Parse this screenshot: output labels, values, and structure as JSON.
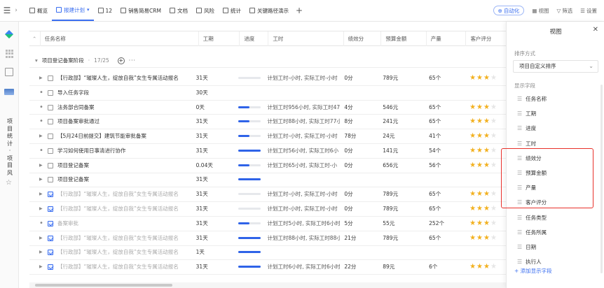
{
  "topbar": {
    "tabs": [
      {
        "label": "概览",
        "icon": "dashboard-icon"
      },
      {
        "label": "报建计划",
        "icon": "table-icon",
        "active": true
      },
      {
        "label": "12",
        "icon": "image-icon"
      },
      {
        "label": "销售简易CRM",
        "icon": "crm-icon"
      },
      {
        "label": "文档",
        "icon": "doc-icon"
      },
      {
        "label": "风险",
        "icon": "warning-icon"
      },
      {
        "label": "统计",
        "icon": "chart-icon"
      },
      {
        "label": "关键路径演示",
        "icon": "gantt-icon"
      }
    ],
    "automation_label": "自动化",
    "view_label": "视图",
    "filter_label": "筛选",
    "settings_label": "设置"
  },
  "rail": {
    "vertical_text": "项目统计·项目风"
  },
  "table": {
    "headers": [
      "任务名称",
      "工期",
      "进度",
      "工时",
      "绩效分",
      "预算金额",
      "产量",
      "客户评分"
    ],
    "group": {
      "title": "项目登记备案阶段",
      "count": "17/25"
    },
    "rows": [
      {
        "name": "【行政部】“璀璨人生，绽放自我”女生专属活动报名",
        "days": "31天",
        "progress": 0,
        "time": "计划工时-小时, 实际工时-小时",
        "perf": "0分",
        "budget": "789元",
        "output": "65个",
        "rating": 3,
        "expand": true,
        "done": false
      },
      {
        "name": "导入任务字段",
        "days": "30天",
        "progress": null,
        "time": "",
        "perf": "",
        "budget": "",
        "output": "",
        "rating": 0,
        "expand": false,
        "done": false
      },
      {
        "name": "法务部合同备案",
        "days": "0天",
        "progress": 0.5,
        "time": "计划工时956小时, 实际工时47",
        "perf": "4分",
        "budget": "546元",
        "output": "65个",
        "rating": 3,
        "expand": false,
        "done": false
      },
      {
        "name": "项目备案审批通过",
        "days": "31天",
        "progress": 0.5,
        "time": "计划工时88小时, 实际工时77小",
        "perf": "8分",
        "budget": "241元",
        "output": "65个",
        "rating": 3,
        "expand": false,
        "done": false
      },
      {
        "name": "【5月24日前提交】建筑节能审批备案",
        "days": "31天",
        "progress": 0.5,
        "time": "计划工时-小时, 实际工时-小时",
        "perf": "78分",
        "budget": "24元",
        "output": "41个",
        "rating": 3,
        "expand": true,
        "done": false
      },
      {
        "name": "学习如何使用日事清进行协作",
        "days": "31天",
        "progress": 1,
        "time": "计划工时56小时, 实际工时6小",
        "perf": "0分",
        "budget": "141元",
        "output": "54个",
        "rating": 3,
        "expand": false,
        "done": false
      },
      {
        "name": "项目登记备案",
        "days": "0.04天",
        "progress": 0.5,
        "time": "计划工时65小时, 实际工时-小",
        "perf": "0分",
        "budget": "656元",
        "output": "56个",
        "rating": 3,
        "expand": true,
        "done": false
      },
      {
        "name": "项目登记备案",
        "days": "31天",
        "progress": 1,
        "time": "",
        "perf": "",
        "budget": "",
        "output": "",
        "rating": 0,
        "expand": true,
        "done": false
      },
      {
        "name": "【行政部】“璀璨人生，绽放自我”女生专属活动报名",
        "days": "31天",
        "progress": 0,
        "time": "计划工时-小时, 实际工时-小时",
        "perf": "0分",
        "budget": "789元",
        "output": "65个",
        "rating": 3,
        "expand": true,
        "done": true
      },
      {
        "name": "【行政部】“璀璨人生，绽放自我”女生专属活动报名",
        "days": "31天",
        "progress": 0,
        "time": "计划工时-小时, 实际工时-小时",
        "perf": "0分",
        "budget": "789元",
        "output": "65个",
        "rating": 3,
        "expand": true,
        "done": true
      },
      {
        "name": "备案审批",
        "days": "31天",
        "progress": 0.5,
        "time": "计划工时5小时, 实际工时6小时",
        "perf": "5分",
        "budget": "55元",
        "output": "252个",
        "rating": 3,
        "expand": false,
        "done": true
      },
      {
        "name": "【行政部】“璀璨人生，绽放自我”女生专属活动报名",
        "days": "31天",
        "progress": 1,
        "time": "计划工时88小时, 实际工时88小",
        "perf": "21分",
        "budget": "789元",
        "output": "65个",
        "rating": 3,
        "expand": true,
        "done": true
      },
      {
        "name": "【行政部】“璀璨人生，绽放自我”女生专属活动报名",
        "days": "1天",
        "progress": 1,
        "time": "",
        "perf": "",
        "budget": "",
        "output": "",
        "rating": 0,
        "expand": true,
        "done": true
      },
      {
        "name": "【行政部】“璀璨人生，绽放自我”女生专属活动报名",
        "days": "31天",
        "progress": 1,
        "time": "计划工时6小时, 实际工时6小时",
        "perf": "22分",
        "budget": "89元",
        "output": "6个",
        "rating": 3,
        "expand": true,
        "done": true
      }
    ]
  },
  "panel": {
    "title": "视图",
    "sort_label": "排序方式",
    "sort_value": "项目自定义排序",
    "display_label": "显示字段",
    "fields": [
      "任务名称",
      "工期",
      "进度",
      "工时",
      "绩效分",
      "预算金额",
      "产量",
      "客户评分",
      "任务类型",
      "任务所属",
      "日期",
      "执行人"
    ],
    "add_field": "+ 添加显示字段"
  },
  "colors": {
    "accent": "#3a6ef0",
    "star": "#f2b01e",
    "highlight": "#e8302a"
  }
}
